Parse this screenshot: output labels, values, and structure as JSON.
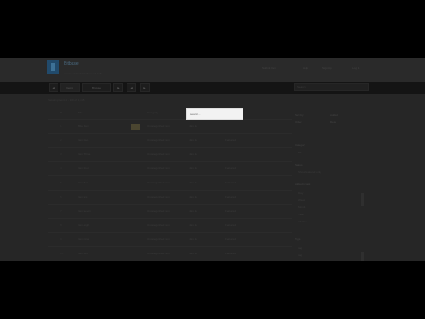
{
  "header": {
    "brand": "Bitbase",
    "tagline": "a user-curated database of stuff",
    "nav": [
      "Submit Item",
      "Help",
      "Sign Up",
      "Log In"
    ]
  },
  "toolbar": {
    "buttons": [
      "◀",
      "Items",
      "Browse",
      "▶",
      "◀",
      "▶"
    ],
    "search_placeholder": "Search"
  },
  "breadcrumb": "Showing items 1 - 100 of 1,245",
  "table": {
    "columns": [
      "#",
      "Title",
      "",
      "Category",
      "Added",
      ""
    ],
    "rows": [
      {
        "num": "1",
        "title": "Blue Item",
        "category": "Uncategorized item",
        "added": "Jan 12",
        "extra": ""
      },
      {
        "num": "2",
        "title": "Item two",
        "category": "Uncategorized item",
        "added": "Jan 12",
        "extra": "Featured"
      },
      {
        "num": "3",
        "title": "Item Three",
        "category": "Uncategorized item",
        "added": "Jan 12",
        "extra": ""
      },
      {
        "num": "4",
        "title": "Item four",
        "category": "Uncategorized item",
        "added": "Jan 12",
        "extra": "Featured"
      },
      {
        "num": "5",
        "title": "Item five",
        "category": "Uncategorized item",
        "added": "Jan 12",
        "extra": "Featured"
      },
      {
        "num": "6",
        "title": "Item six",
        "category": "Uncategorized item",
        "added": "Jan 12",
        "extra": "Featured"
      },
      {
        "num": "7",
        "title": "Item seven",
        "category": "Uncategorized item",
        "added": "Jan 12",
        "extra": "Featured"
      },
      {
        "num": "8",
        "title": "Item eight",
        "category": "Uncategorized item",
        "added": "Jan 12",
        "extra": "Featured"
      },
      {
        "num": "9",
        "title": "Item nine",
        "category": "Uncategorized item",
        "added": "Jan 12",
        "extra": "Featured"
      },
      {
        "num": "10",
        "title": "Item ten",
        "category": "Uncategorized item",
        "added": "Jan 12",
        "extra": "Featured"
      }
    ]
  },
  "popup": {
    "text": "search..."
  },
  "sidebar": {
    "sort_label": "Sort by",
    "sort_value": "Added",
    "order_label": "Order",
    "order_value": "Desc",
    "section1": "Category",
    "section1_items": [
      "All"
    ],
    "section2": "Status",
    "section2_items": [
      "Show featured only"
    ],
    "section3": "Added in last",
    "section3_items": [
      "Day",
      "Week",
      "Month",
      "Year",
      "All time"
    ],
    "section4": "Tags",
    "section4_items": [
      "tag",
      "tag"
    ]
  }
}
